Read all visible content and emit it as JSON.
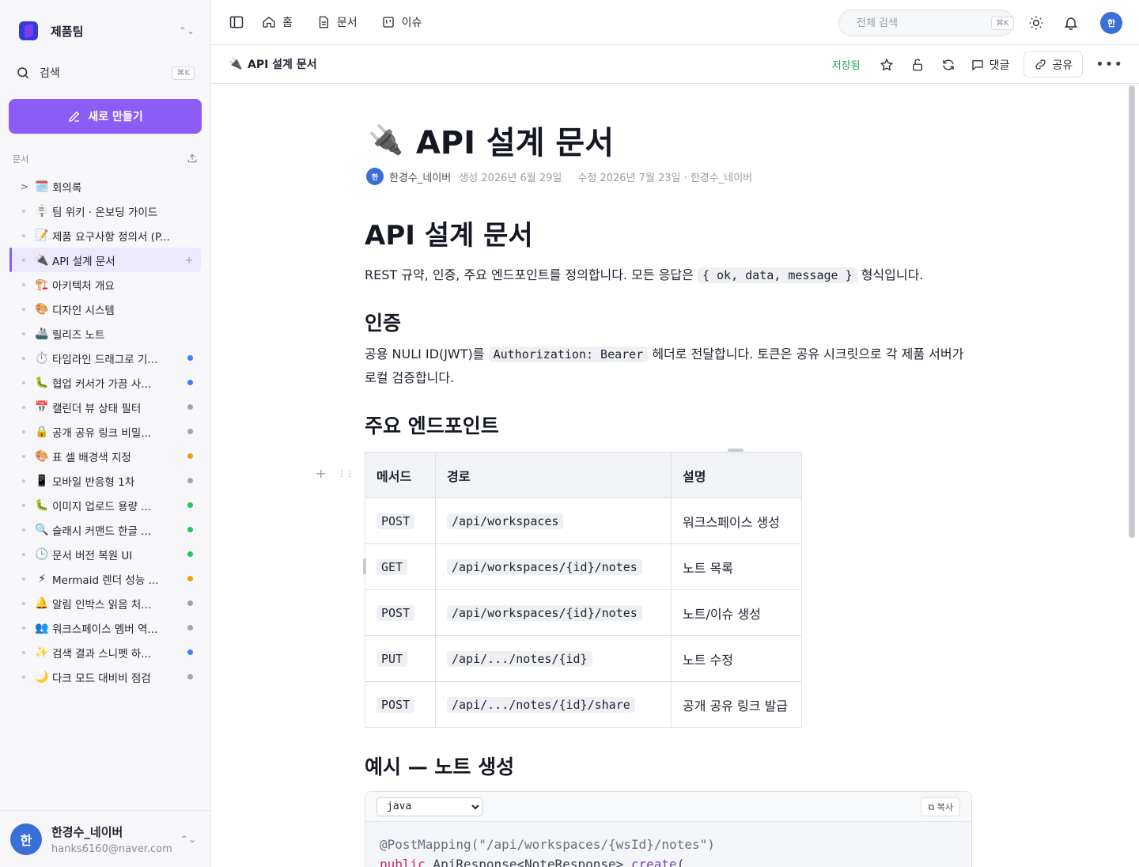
{
  "sidebar": {
    "workspace_name": "제품팀",
    "search_label": "검색",
    "search_shortcut": "⌘K",
    "new_button": "새로 만들기",
    "section_label": "문서",
    "docs": [
      {
        "emoji": "🗓️",
        "title": "회의록",
        "caret": true,
        "dot": null
      },
      {
        "emoji": "🪧",
        "title": "팀 위키 · 온보딩 가이드",
        "dot": null
      },
      {
        "emoji": "📝",
        "title": "제품 요구사항 정의서 (P...",
        "dot": null
      },
      {
        "emoji": "🔌",
        "title": "API 설계 문서",
        "dot": null,
        "active": true
      },
      {
        "emoji": "🏗️",
        "title": "아키텍처 개요",
        "dot": null
      },
      {
        "emoji": "🎨",
        "title": "디자인 시스템",
        "dot": null
      },
      {
        "emoji": "🚢",
        "title": "릴리즈 노트",
        "dot": null
      },
      {
        "emoji": "⏱️",
        "title": "타임라인 드래그로 기...",
        "dot": "#3b82f6"
      },
      {
        "emoji": "🐛",
        "title": "협업 커서가 가끔 사...",
        "dot": "#3b82f6"
      },
      {
        "emoji": "📅",
        "title": "캘린더 뷰 상태 필터",
        "dot": "#a1a4ae"
      },
      {
        "emoji": "🔒",
        "title": "공개 공유 링크 비밀...",
        "dot": "#a1a4ae"
      },
      {
        "emoji": "🎨",
        "title": "표 셀 배경색 지정",
        "dot": "#f59e0b"
      },
      {
        "emoji": "📱",
        "title": "모바일 반응형 1차",
        "dot": "#a1a4ae"
      },
      {
        "emoji": "🐛",
        "title": "이미지 업로드 용량 ...",
        "dot": "#22c55e"
      },
      {
        "emoji": "🔍",
        "title": "슬래시 커맨드 한글 ...",
        "dot": "#22c55e"
      },
      {
        "emoji": "🕒",
        "title": "문서 버전 복원 UI",
        "dot": "#22c55e"
      },
      {
        "emoji": "⚡",
        "title": "Mermaid 렌더 성능 ...",
        "dot": "#f59e0b"
      },
      {
        "emoji": "🔔",
        "title": "알림 인박스 읽음 처...",
        "dot": "#a1a4ae"
      },
      {
        "emoji": "👥",
        "title": "워크스페이스 멤버 역...",
        "dot": "#a1a4ae"
      },
      {
        "emoji": "✨",
        "title": "검색 결과 스니펫 하...",
        "dot": "#3b82f6"
      },
      {
        "emoji": "🌙",
        "title": "다크 모드 대비비 점검",
        "dot": "#a1a4ae"
      }
    ],
    "user": {
      "initial": "한",
      "name": "한경수_네이버",
      "email": "hanks6160@naver.com"
    }
  },
  "topbar": {
    "nav": [
      {
        "icon": "home-icon",
        "label": "홈"
      },
      {
        "icon": "document-icon",
        "label": "문서"
      },
      {
        "icon": "issue-icon",
        "label": "이슈"
      }
    ],
    "search_placeholder": "전체 검색",
    "search_shortcut": "⌘K",
    "avatar_initial": "한"
  },
  "docbar": {
    "emoji": "🔌",
    "title": "API 설계 문서",
    "saved": "저장됨",
    "comment": "댓글",
    "share": "공유"
  },
  "document": {
    "emoji": "🔌",
    "title": "API 설계 문서",
    "author_initial": "한",
    "author": "한경수_네이버",
    "created": "생성 2026년 6월 29일",
    "modified": "수정 2026년 7월 23일 · 한경수_네이버",
    "h1": "API 설계 문서",
    "intro_before": "REST 규약, 인증, 주요 엔드포인트를 정의합니다. 모든 응답은 ",
    "intro_code": "{ ok, data, message }",
    "intro_after": " 형식입니다.",
    "auth_heading": "인증",
    "auth_before": "공용 NULI ID(JWT)를 ",
    "auth_code": "Authorization: Bearer",
    "auth_after": " 헤더로 전달합니다. 토큰은 공유 시크릿으로 각 제품 서버가 로컬 검증합니다.",
    "endpoints_heading": "주요 엔드포인트",
    "table": {
      "headers": [
        "메서드",
        "경로",
        "설명"
      ],
      "rows": [
        [
          "POST",
          "/api/workspaces",
          "워크스페이스 생성"
        ],
        [
          "GET",
          "/api/workspaces/{id}/notes",
          "노트 목록"
        ],
        [
          "POST",
          "/api/workspaces/{id}/notes",
          "노트/이슈 생성"
        ],
        [
          "PUT",
          "/api/.../notes/{id}",
          "노트 수정"
        ],
        [
          "POST",
          "/api/.../notes/{id}/share",
          "공개 공유 링크 발급"
        ]
      ]
    },
    "example_heading": "예시 — 노트 생성",
    "code_lang": "java",
    "copy_label": "⧉ 복사",
    "code_line1": "@PostMapping(\"/api/workspaces/{wsId}/notes\")",
    "code_line2_kw": "public",
    "code_line2_type": " ApiResponse<NoteResponse> ",
    "code_line2_fn": "create",
    "code_line2_end": "("
  }
}
